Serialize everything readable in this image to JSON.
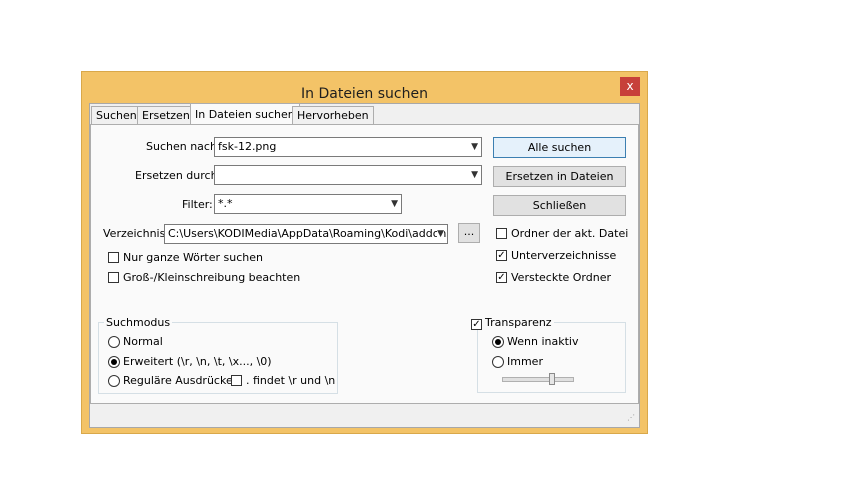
{
  "window": {
    "title": "In Dateien suchen",
    "close_glyph": "x"
  },
  "tabs": [
    {
      "label": "Suchen"
    },
    {
      "label": "Ersetzen"
    },
    {
      "label": "In Dateien suchen"
    },
    {
      "label": "Hervorheben"
    }
  ],
  "form": {
    "find_label": "Suchen nach:",
    "find_value": "fsk-12.png",
    "replace_label": "Ersetzen durch:",
    "replace_value": "",
    "filter_label": "Filter:",
    "filter_value": "*.*",
    "dir_label": "Verzeichnis:",
    "dir_value": "C:\\Users\\KODIMedia\\AppData\\Roaming\\Kodi\\addons\\s",
    "browse_label": "..."
  },
  "buttons": {
    "find_all": "Alle suchen",
    "replace_in_files": "Ersetzen in Dateien",
    "close": "Schließen"
  },
  "options": {
    "whole_word": "Nur ganze Wörter suchen",
    "match_case": "Groß-/Kleinschreibung beachten",
    "follow_doc": "Ordner der akt. Datei",
    "subfolders": "Unterverzeichnisse",
    "hidden_folders": "Versteckte Ordner"
  },
  "search_mode": {
    "title": "Suchmodus",
    "normal": "Normal",
    "extended": "Erweitert (\\r, \\n, \\t, \\x..., \\0)",
    "regex": "Reguläre Ausdrücke",
    "dot_newline": ". findet \\r und \\n"
  },
  "transparency": {
    "title": "Transparenz",
    "on_losing_focus": "Wenn inaktiv",
    "always": "Immer"
  }
}
